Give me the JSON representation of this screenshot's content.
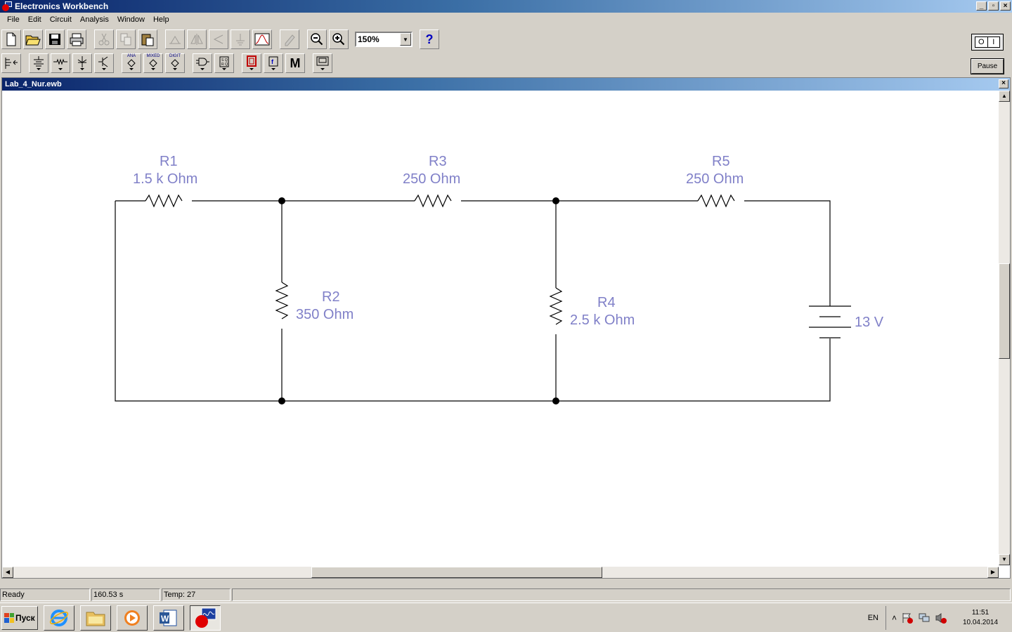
{
  "app": {
    "title": "Electronics Workbench"
  },
  "window_buttons": {
    "minimize": "_",
    "restore": "▫",
    "close": "×"
  },
  "menu": [
    "File",
    "Edit",
    "Circuit",
    "Analysis",
    "Window",
    "Help"
  ],
  "toolbar": {
    "zoom_value": "150%",
    "help_label": "?",
    "parts_tags": {
      "analog": "ANA",
      "mixed": "MIXED",
      "digital": "DIGIT"
    },
    "misc_label": "M"
  },
  "power": {
    "on_label": "O",
    "off_label": "I"
  },
  "pause_label": "Pause",
  "document": {
    "title": "Lab_4_Nur.ewb",
    "close": "×"
  },
  "circuit": {
    "components": [
      {
        "id": "R1",
        "value": "1.5 k Ohm"
      },
      {
        "id": "R2",
        "value": "350  Ohm"
      },
      {
        "id": "R3",
        "value": "250  Ohm"
      },
      {
        "id": "R4",
        "value": "2.5 k Ohm"
      },
      {
        "id": "R5",
        "value": "250  Ohm"
      },
      {
        "id": "battery",
        "value": "13 V"
      }
    ],
    "label_color": "#8080c8"
  },
  "status": {
    "ready": "Ready",
    "time": "160.53 s",
    "temp": "Temp:  27"
  },
  "taskbar": {
    "start_label": "Пуск",
    "lang": "EN",
    "tray_expand": "˄",
    "time": "11:51",
    "date": "10.04.2014"
  }
}
